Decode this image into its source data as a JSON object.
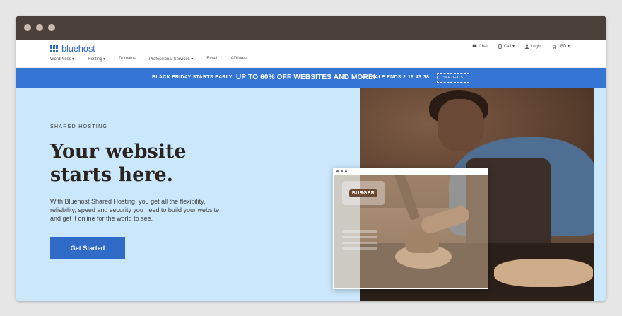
{
  "logo": {
    "text": "bluehost"
  },
  "nav": {
    "items": [
      "WordPress ▾",
      "Hosting ▾",
      "Domains",
      "Professional Services ▾",
      "Email",
      "Affiliates"
    ]
  },
  "utility": {
    "chat": "Chat",
    "call": "Call ▾",
    "login": "Login",
    "currency": "USD ▾"
  },
  "promo": {
    "lead": "BLACK FRIDAY STARTS EARLY",
    "offer": "UP TO 60% OFF WEBSITES AND MORE!",
    "countdown": "SALE ENDS 2:16:43:38",
    "button": "SEE DEALS"
  },
  "hero": {
    "eyebrow": "SHARED HOSTING",
    "headline": "Your website starts here.",
    "description": "With Bluehost Shared Hosting, you get all the flexibility, reliability, speed and security you need to build your website and get it online for the world to see.",
    "cta": "Get Started"
  },
  "mockup": {
    "badge": "BURGER"
  },
  "colors": {
    "brand": "#2f6bc7",
    "promo_bg": "#3575d3",
    "hero_bg": "#cbe7fb",
    "chrome": "#4b3f3a"
  }
}
